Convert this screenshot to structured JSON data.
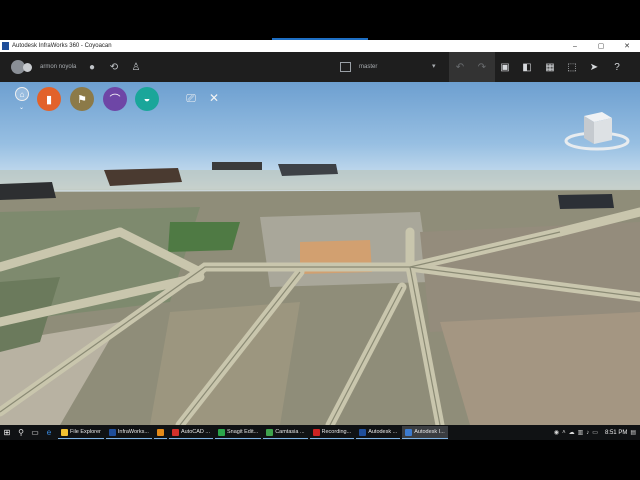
{
  "window": {
    "title": "Autodesk InfraWorks 360 - Coyoacan",
    "minimize": "–",
    "maximize": "▢",
    "close": "✕"
  },
  "toolbar": {
    "user_name": "armon noyola",
    "branch": "master",
    "icons": [
      "avatar",
      "chat-icon",
      "sync-icon",
      "person-icon",
      "undo-icon",
      "redo-icon",
      "bookmark-icon",
      "panel-icon",
      "grid-icon",
      "select-icon",
      "cursor-icon",
      "help-icon"
    ]
  },
  "viewport": {
    "home_label": "⌂",
    "tools": [
      {
        "name": "create-manage-tool",
        "color": "#e2622a",
        "glyph": "▮"
      },
      {
        "name": "analyze-tool",
        "color": "#8c7a48",
        "glyph": "⚑"
      },
      {
        "name": "bridge-design-tool",
        "color": "#6e46a6",
        "glyph": "⌒"
      },
      {
        "name": "present-tool",
        "color": "#1aa69a",
        "glyph": "◒"
      }
    ],
    "view_icons": [
      "screen-icon",
      "measure-icon"
    ]
  },
  "taskbar": {
    "tasks": [
      {
        "label": "File Explorer",
        "color": "#f2c232",
        "active": false
      },
      {
        "label": "InfraWorks...",
        "color": "#1f4e9a",
        "active": false
      },
      {
        "label": "",
        "color": "#e68a17",
        "active": false
      },
      {
        "label": "AutoCAD ...",
        "color": "#d3312b",
        "active": false
      },
      {
        "label": "Snagit Edit...",
        "color": "#2ba64b",
        "active": false
      },
      {
        "label": "Camtasia ...",
        "color": "#3fa34d",
        "active": false
      },
      {
        "label": "Recording...",
        "color": "#c22",
        "active": false
      },
      {
        "label": "Autodesk ...",
        "color": "#1f4e9a",
        "active": false
      },
      {
        "label": "Autodesk I...",
        "color": "#3b7bd0",
        "active": true
      }
    ],
    "clock": "8:51 PM"
  }
}
